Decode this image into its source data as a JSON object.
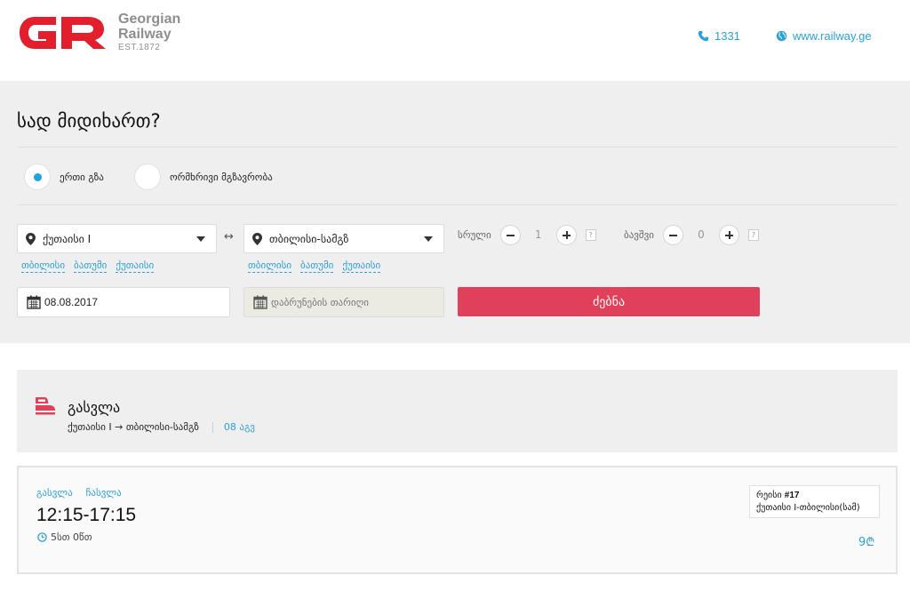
{
  "brand": {
    "line1": "Georgian",
    "line2": "Railway",
    "line3": "EST.1872",
    "color": "#e31e2d"
  },
  "header": {
    "phone": "1331",
    "website": "www.railway.ge"
  },
  "search": {
    "title": "სად მიდიხართ?",
    "trip_types": [
      {
        "label": "ერთი გზა",
        "checked": true
      },
      {
        "label": "ორმხრივი მგზავრობა",
        "checked": false
      }
    ],
    "from": {
      "value": "ქუთაისი I",
      "quick": [
        "თბილისი",
        "ბათუმი",
        "ქუთაისი"
      ]
    },
    "swap_symbol": "↔",
    "to": {
      "value": "თბილისი-სამგზ",
      "quick": [
        "თბილისი",
        "ბათუმი",
        "ქუთაისი"
      ]
    },
    "adults": {
      "label": "სრული",
      "value": "1",
      "help": "?"
    },
    "children": {
      "label": "ბავშვი",
      "value": "0",
      "help": "?"
    },
    "departure_date": "08.08.2017",
    "return_date_placeholder": "დაბრუნების თარიღი",
    "search_button": "ძებნა",
    "accent": "#e0405a"
  },
  "results": {
    "section_title": "გასვლა",
    "route": "ქუთაისი I → თბილისი-სამგზ",
    "date": "08 აგვ",
    "trips": [
      {
        "departure_label": "გასვლა",
        "arrival_label": "ჩასვლა",
        "time": "12:15-17:15",
        "duration": "5სთ 0წთ",
        "train_prefix": "რეისი ",
        "train_number": "#17",
        "train_route": "ქუთაისი I-თბილისი(სამ)",
        "price": "9₾"
      }
    ]
  }
}
